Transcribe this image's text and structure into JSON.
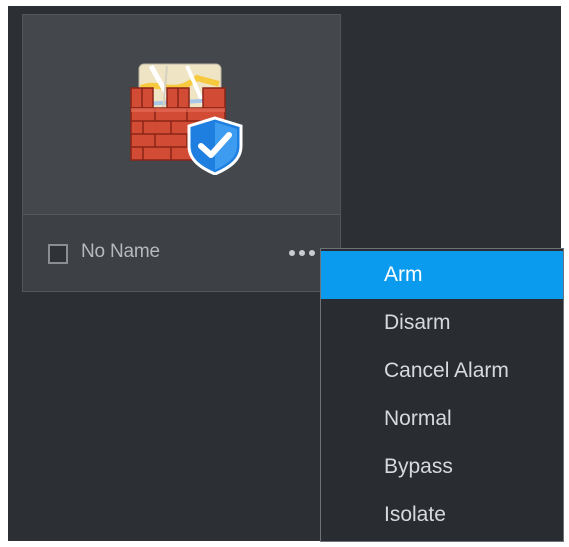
{
  "card": {
    "name": "No Name",
    "icon": "firewall-map-shield-icon",
    "checked": false
  },
  "more_button": {
    "icon": "ellipsis-icon"
  },
  "context_menu": {
    "items": [
      {
        "label": "Arm",
        "selected": true
      },
      {
        "label": "Disarm",
        "selected": false
      },
      {
        "label": "Cancel Alarm",
        "selected": false
      },
      {
        "label": "Normal",
        "selected": false
      },
      {
        "label": "Bypass",
        "selected": false
      },
      {
        "label": "Isolate",
        "selected": false
      }
    ]
  },
  "colors": {
    "background": "#2c2f33",
    "card": "#3d4045",
    "menu_background": "#292c30",
    "menu_highlight": "#0a9bef",
    "text": "#d7dadd"
  }
}
